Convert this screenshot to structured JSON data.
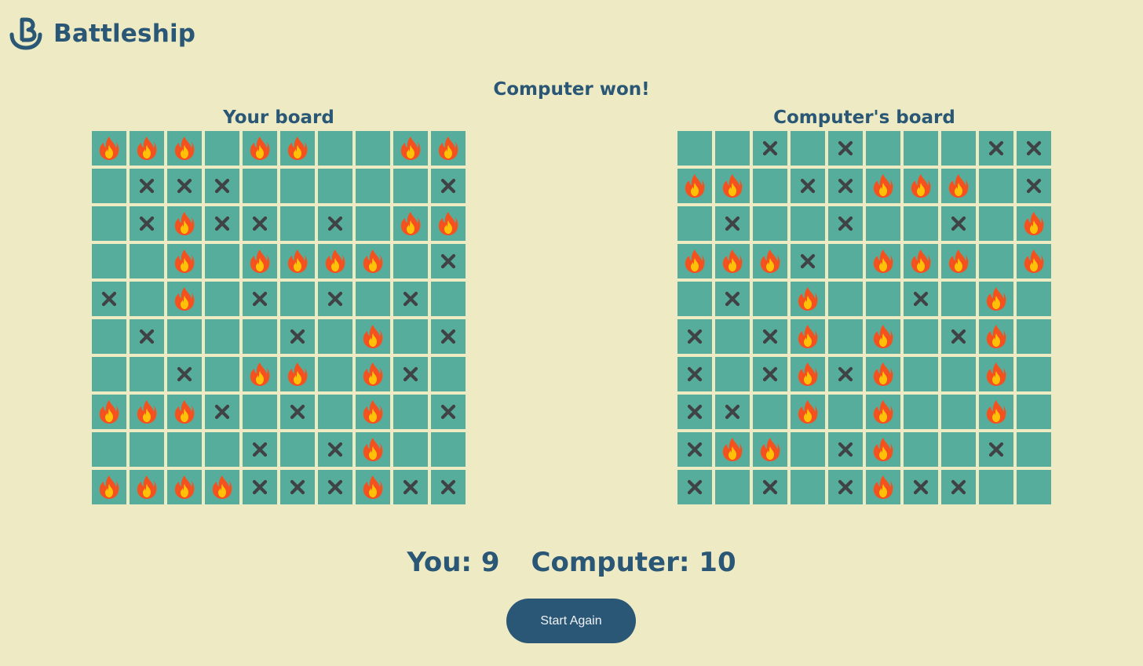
{
  "app": {
    "title": "Battleship"
  },
  "game": {
    "status": "Computer won!"
  },
  "boards": {
    "player": {
      "title": "Your board",
      "rows": [
        "FFF.FF..FF",
        ".XXX.....X",
        ".XFXX.X.FF",
        "..F.FFFF.X",
        "X.F.X.X.X.",
        ".X...X.F.X",
        "..X.FF.FX.",
        "FFFX.X.F.X",
        "....X.XF..",
        "FFFFXXXFXX"
      ]
    },
    "computer": {
      "title": "Computer's board",
      "rows": [
        "..X.X...XX",
        "FF.XXFFF.X",
        ".X..X..X.F",
        "FFFX.FFF.F",
        ".X.F..X.F.",
        "X.XF.F.XF.",
        "X.XFXF..F.",
        "XX.F.F..F.",
        "XFF.XF..X.",
        "X.X.XFXX.."
      ]
    }
  },
  "scores": {
    "you_label": "You: 9",
    "computer_label": "Computer: 10"
  },
  "actions": {
    "start_again_label": "Start Again"
  },
  "legend": {
    "X": "miss-x-icon",
    "F": "fire-icon",
    ".": "empty"
  },
  "colors": {
    "background": "#eeebc4",
    "cell": "#56ad9c",
    "text": "#2b5776",
    "button": "#2b5776",
    "miss_mark": "#3f4345",
    "fire_outer": "#f4511e",
    "fire_inner": "#ffc107"
  }
}
